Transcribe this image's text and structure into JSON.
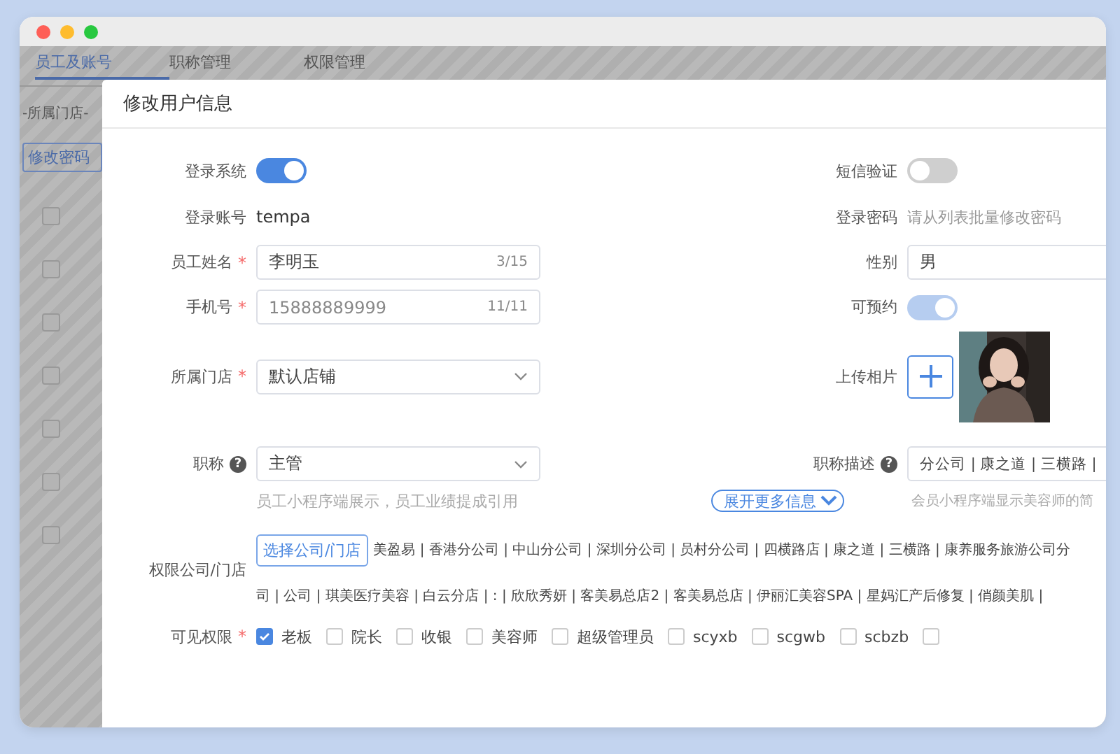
{
  "background_page": {
    "tabs": [
      {
        "label": "员工及账号",
        "selected": true
      },
      {
        "label": "职称管理",
        "selected": false
      },
      {
        "label": "权限管理",
        "selected": false
      }
    ],
    "store_filter": "-所属门店-",
    "change_password_button": "修改密码",
    "rows": [
      {
        "checked": false
      },
      {
        "checked": false
      },
      {
        "checked": false
      },
      {
        "checked": false
      },
      {
        "checked": false
      },
      {
        "checked": false
      },
      {
        "checked": false
      }
    ]
  },
  "dialog": {
    "title": "修改用户信息",
    "required_mark": "*",
    "help_mark": "?",
    "login_system": {
      "label": "登录系统",
      "on": true,
      "disabled": false
    },
    "sms_verify": {
      "label": "短信验证",
      "on": false,
      "disabled": false
    },
    "account": {
      "label": "登录账号",
      "value": "tempa"
    },
    "password": {
      "label": "登录密码",
      "value": "请从列表批量修改密码"
    },
    "name": {
      "label": "员工姓名",
      "required": true,
      "value": "李明玉",
      "count": "3/15"
    },
    "gender": {
      "label": "性别",
      "value": "男"
    },
    "phone": {
      "label": "手机号",
      "required": true,
      "value": "15888889999",
      "count": "11/11"
    },
    "bookable": {
      "label": "可预约",
      "on": true,
      "disabled": true
    },
    "store": {
      "label": "所属门店",
      "required": true,
      "value": "默认店铺"
    },
    "photo": {
      "label": "上传相片",
      "kind": "picture"
    },
    "title_field": {
      "label": "职称",
      "help": true,
      "value": "主管",
      "hint": "员工小程序端展示，员工业绩提成引用"
    },
    "title_desc": {
      "label": "职称描述",
      "help": true,
      "value": "分公司 | 康之道 | 三横路 |",
      "hint": "会员小程序端显示美容师的简"
    },
    "expand_button": "展开更多信息",
    "companies": {
      "label": "权限公司/门店",
      "select_button": "选择公司/门店",
      "lines": [
        "美盈易 | 香港分公司 | 中山分公司 | 深圳分公司 | 员村分公司 | 四横路店 | 康之道 | 三横路 | 康养服务旅游公司分",
        "司 | 公司 | 琪美医疗美容 | 白云分店 | : | 欣欣秀妍 | 客美易总店2 | 客美易总店 | 伊丽汇美容SPA | 星妈汇产后修复 | 俏颜美肌 |"
      ]
    },
    "visibility": {
      "label": "可见权限",
      "required": true,
      "options": [
        {
          "label": "老板",
          "checked": true
        },
        {
          "label": "院长",
          "checked": false
        },
        {
          "label": "收银",
          "checked": false
        },
        {
          "label": "美容师",
          "checked": false
        },
        {
          "label": "超级管理员",
          "checked": false
        },
        {
          "label": "scyxb",
          "checked": false
        },
        {
          "label": "scgwb",
          "checked": false
        },
        {
          "label": "scbzb",
          "checked": false
        },
        {
          "checked": false
        }
      ]
    }
  }
}
